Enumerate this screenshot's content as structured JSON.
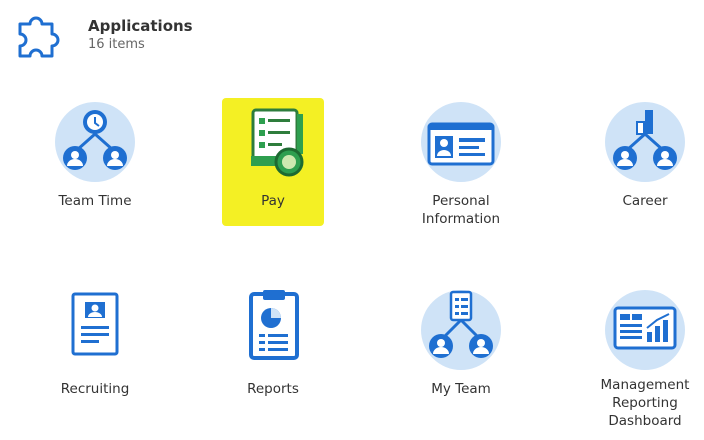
{
  "header": {
    "title": "Applications",
    "count": "16 items",
    "icon": "puzzle-icon"
  },
  "apps": [
    {
      "label": "Team Time",
      "icon": "team-time-icon"
    },
    {
      "label": "Pay",
      "icon": "pay-icon",
      "highlighted": true
    },
    {
      "label": "Personal\nInformation",
      "icon": "id-card-icon"
    },
    {
      "label": "Career",
      "icon": "career-icon"
    },
    {
      "label": "Recruiting",
      "icon": "resume-icon"
    },
    {
      "label": "Reports",
      "icon": "clipboard-report-icon"
    },
    {
      "label": "My Team",
      "icon": "my-team-icon"
    },
    {
      "label": "Management\nReporting\nDashboard",
      "icon": "dashboard-icon"
    }
  ],
  "colors": {
    "icon_bg": "#cfe3f7",
    "icon_blue": "#1f6fd1",
    "icon_light": "#ffffff",
    "highlight": "#f4f024",
    "pay_green": "#2e9f4f"
  }
}
